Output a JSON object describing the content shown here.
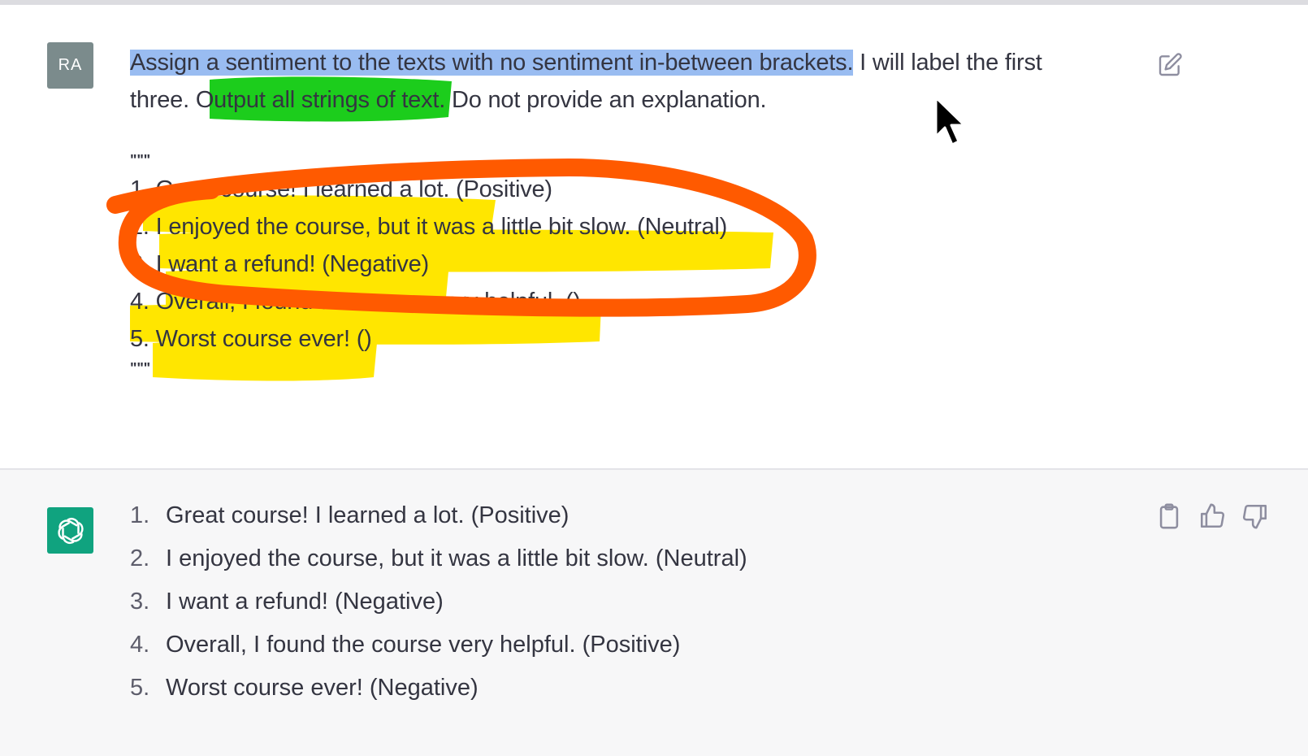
{
  "user": {
    "avatar_initials": "RA",
    "prompt_selected": "Assign a sentiment to the texts with no sentiment in-between brackets.",
    "prompt_rest_line1": " I will label the first",
    "prompt_line2": "three. Output all strings of text. Do not provide an explanation.",
    "quote_open": "\"\"\"",
    "items": [
      "1. Great course! I learned a lot. (Positive)",
      "2. I enjoyed the course, but it was a little bit slow. (Neutral)",
      "3. I want a refund! (Negative)",
      "4. Overall, I found the course very helpful. ()",
      "5. Worst course ever! ()"
    ],
    "quote_close": "\"\"\""
  },
  "assistant": {
    "avatar_icon": "openai-logo-icon",
    "items": [
      {
        "num": "1.",
        "text": "Great course! I learned a lot. (Positive)"
      },
      {
        "num": "2.",
        "text": "I enjoyed the course, but it was a little bit slow. (Neutral)"
      },
      {
        "num": "3.",
        "text": "I want a refund! (Negative)"
      },
      {
        "num": "4.",
        "text": "Overall, I found the course very helpful. (Positive)"
      },
      {
        "num": "5.",
        "text": "Worst course ever! (Negative)"
      }
    ]
  },
  "icons": {
    "edit": "edit-icon",
    "copy": "clipboard-icon",
    "thumbs_up": "thumbs-up-icon",
    "thumbs_down": "thumbs-down-icon",
    "cursor": "mouse-cursor-icon"
  },
  "colors": {
    "highlight_yellow": "#ffe600",
    "highlight_green": "#1ccd1c",
    "selection_blue": "#87b0ee",
    "circle_orange": "#ff5a00",
    "assistant_bg": "#f7f7f8",
    "user_avatar": "#7b8b8c",
    "bot_avatar": "#10a37f"
  }
}
